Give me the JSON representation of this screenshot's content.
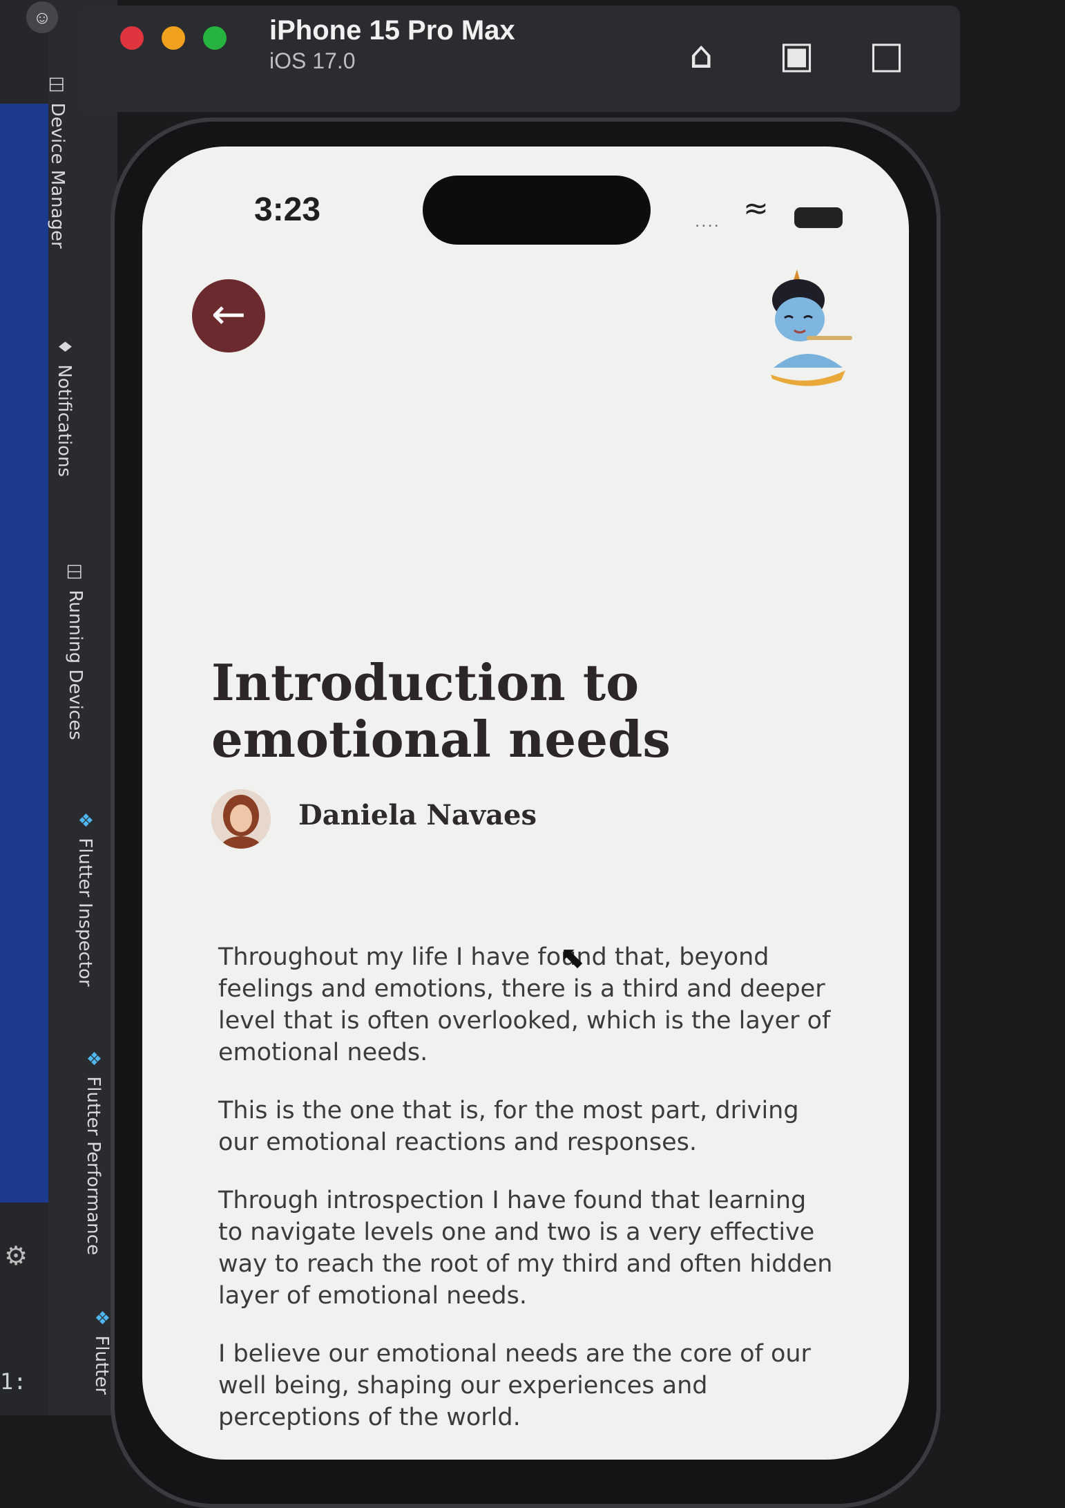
{
  "ide": {
    "tool_windows": [
      {
        "label": "Device Manager",
        "icon": "device-icon"
      },
      {
        "label": "Notifications",
        "icon": "bell-icon"
      },
      {
        "label": "Running Devices",
        "icon": "devices-icon"
      },
      {
        "label": "Flutter Inspector",
        "icon": "flutter-icon"
      },
      {
        "label": "Flutter Performance",
        "icon": "flutter-icon"
      },
      {
        "label": "Flutter",
        "icon": "flutter-icon"
      }
    ],
    "corner_text": "1:"
  },
  "simulator": {
    "device_name": "iPhone 15 Pro Max",
    "os_version": "iOS 17.0",
    "traffic_lights": [
      "#e0343f",
      "#f0a21e",
      "#27b33f"
    ]
  },
  "app": {
    "status": {
      "time": "3:23",
      "signal": "....",
      "wifi_icon": "wifi-icon",
      "battery_icon": "battery-icon"
    },
    "back_icon": "arrow-left-icon",
    "accent_color": "#6b2a2e",
    "title_line1": "Introduction to",
    "title_line2": "emotional needs",
    "author_name": "Daniela Navaes",
    "paragraphs": [
      "Throughout my life I have found that, beyond feelings and emotions, there is a third and deeper level that is often overlooked, which is the layer of emotional needs.",
      "This is the one that is, for the most part, driving our emotional reactions and responses.",
      "Through introspection I have found that learning to navigate levels one and two is a very effective way to reach the root of my third and often hidden layer of emotional needs.",
      "I believe our emotional needs are the core of our well being, shaping our experiences and perceptions of the world."
    ]
  }
}
